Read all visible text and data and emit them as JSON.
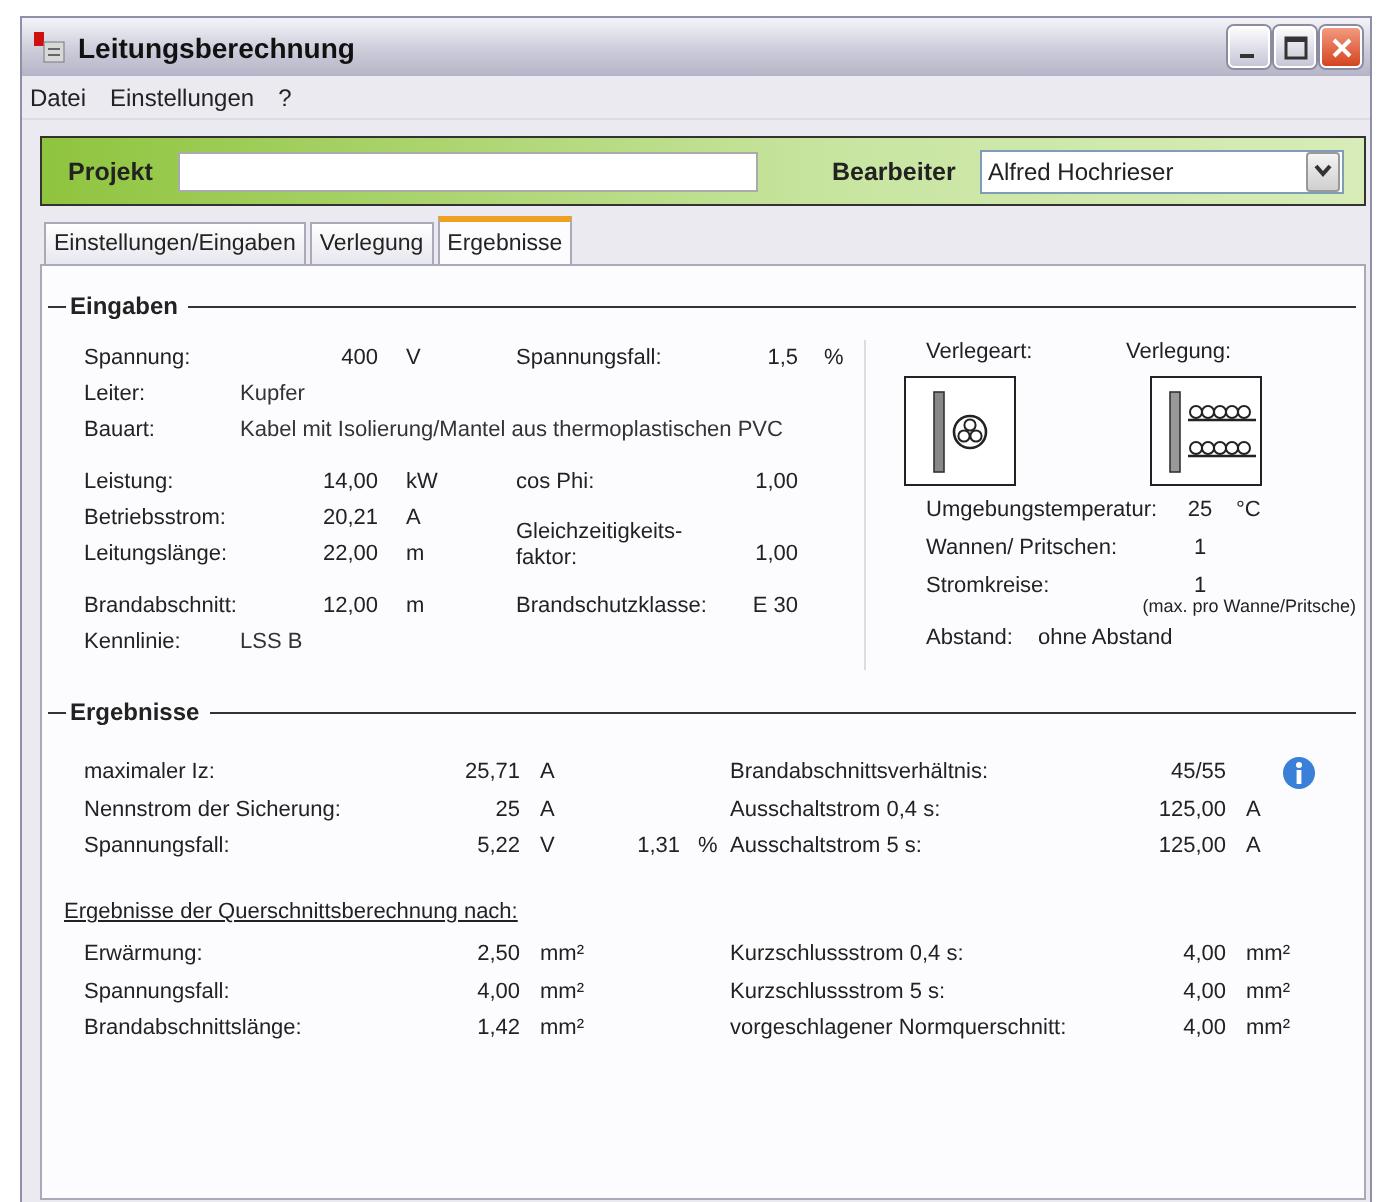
{
  "window": {
    "title": "Leitungsberechnung"
  },
  "menu": [
    "Datei",
    "Einstellungen",
    "?"
  ],
  "project_bar": {
    "project_label": "Projekt",
    "editor_label": "Bearbeiter",
    "editor_value": "Alfred Hochrieser"
  },
  "tabs": [
    {
      "label": "Einstellungen/Eingaben",
      "selected": false
    },
    {
      "label": "Verlegung",
      "selected": false
    },
    {
      "label": "Ergebnisse",
      "selected": true
    }
  ],
  "inputs": {
    "title": "Eingaben",
    "groups": [
      [
        {
          "kind": "pair",
          "label": "Spannung:",
          "value": "400",
          "unit": "V",
          "label2": "Spannungsfall:",
          "value2": "1,5",
          "unit2": "%"
        },
        {
          "kind": "text",
          "label": "Leiter:",
          "value": "Kupfer"
        },
        {
          "kind": "text",
          "label": "Bauart:",
          "value": "Kabel mit Isolierung/Mantel aus thermoplastischen PVC"
        }
      ],
      [
        {
          "kind": "pair",
          "label": "Leistung:",
          "value": "14,00",
          "unit": "kW",
          "label2": "cos Phi:",
          "value2": "1,00"
        },
        {
          "kind": "pair-wrap",
          "label": "Betriebsstrom:",
          "value": "20,21",
          "unit": "A",
          "label2": "Gleichzeitigkeits-faktor:",
          "value2": "1,00"
        },
        {
          "kind": "pair",
          "label": "Leitungslänge:",
          "value": "22,00",
          "unit": "m"
        }
      ],
      [
        {
          "kind": "pair",
          "label": "Brandabschnitt:",
          "value": "12,00",
          "unit": "m",
          "label2": "Brandschutzklasse:",
          "value2": "E 30"
        },
        {
          "kind": "text",
          "label": "Kennlinie:",
          "value": "LSS B"
        }
      ]
    ],
    "laying": {
      "type_label": "Verlegeart:",
      "laying_label": "Verlegung:",
      "rows": [
        {
          "label": "Umgebungstemperatur:",
          "value": "25",
          "unit": "°C"
        },
        {
          "label": "Wannen/ Pritschen:",
          "value": "1"
        },
        {
          "label": "Stromkreise:",
          "value": "1",
          "note": "(max. pro Wanne/Pritsche)"
        }
      ],
      "distance_label": "Abstand:",
      "distance_value": "ohne Abstand"
    }
  },
  "results": {
    "title": "Ergebnisse",
    "rows": [
      {
        "label": "maximaler Iz:",
        "value": "25,71",
        "unit": "A",
        "label2": "Brandabschnittsverhältnis:",
        "value2": "45/55",
        "info": true
      },
      {
        "label": "Nennstrom der Sicherung:",
        "value": "25",
        "unit": "A",
        "label2": "Ausschaltstrom 0,4 s:",
        "value2": "125,00",
        "unit2": "A"
      },
      {
        "label": "Spannungsfall:",
        "value": "5,22",
        "unit": "V",
        "extra": "1,31",
        "extra_unit": "%",
        "label2": "Ausschaltstrom 5 s:",
        "value2": "125,00",
        "unit2": "A"
      }
    ],
    "cross_section_title": "Ergebnisse der Querschnittsberechnung nach:",
    "cross_section_rows": [
      {
        "label": "Erwärmung:",
        "value": "2,50",
        "unit": "mm²",
        "label2": "Kurzschlussstrom 0,4 s:",
        "value2": "4,00",
        "unit2": "mm²"
      },
      {
        "label": "Spannungsfall:",
        "value": "4,00",
        "unit": "mm²",
        "label2": "Kurzschlussstrom 5 s:",
        "value2": "4,00",
        "unit2": "mm²"
      },
      {
        "label": "Brandabschnittslänge:",
        "value": "1,42",
        "unit": "mm²",
        "label2": "vorgeschlagener Normquerschnitt:",
        "value2": "4,00",
        "unit2": "mm²"
      }
    ]
  }
}
